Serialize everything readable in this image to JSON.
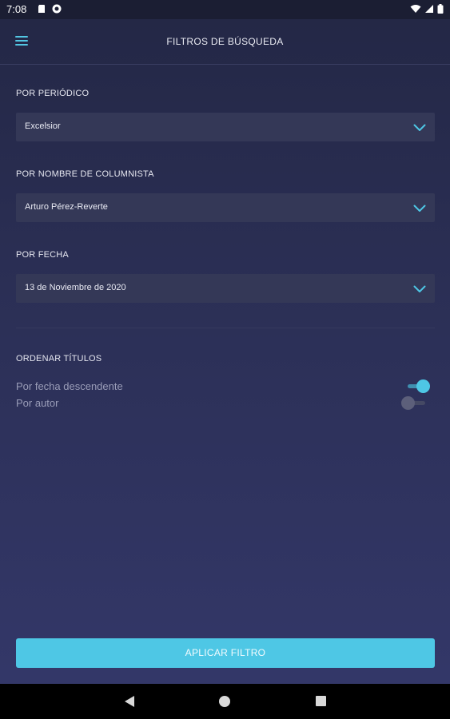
{
  "status_bar": {
    "time": "7:08"
  },
  "app_bar": {
    "title": "FILTROS DE BÚSQUEDA"
  },
  "filters": {
    "periodico": {
      "label": "POR PERIÓDICO",
      "value": "Excelsior"
    },
    "columnista": {
      "label": "POR NOMBRE DE COLUMNISTA",
      "value": "Arturo Pérez-Reverte"
    },
    "fecha": {
      "label": "POR FECHA",
      "value": "13 de Noviembre de 2020"
    }
  },
  "sort": {
    "label": "ORDENAR TÍTULOS",
    "options": [
      {
        "label": "Por fecha descendente",
        "enabled": true
      },
      {
        "label": "Por autor",
        "enabled": false
      }
    ]
  },
  "apply_button": {
    "label": "APLICAR FILTRO"
  },
  "colors": {
    "accent": "#4ec7e5",
    "background": "#2b2f55",
    "dropdown": "#343857",
    "toggle_off": "#5c5f7a"
  },
  "icons": {
    "menu": "menu-icon",
    "chevron": "chevron-down-icon",
    "wifi": "wifi-icon",
    "battery": "battery-icon"
  }
}
